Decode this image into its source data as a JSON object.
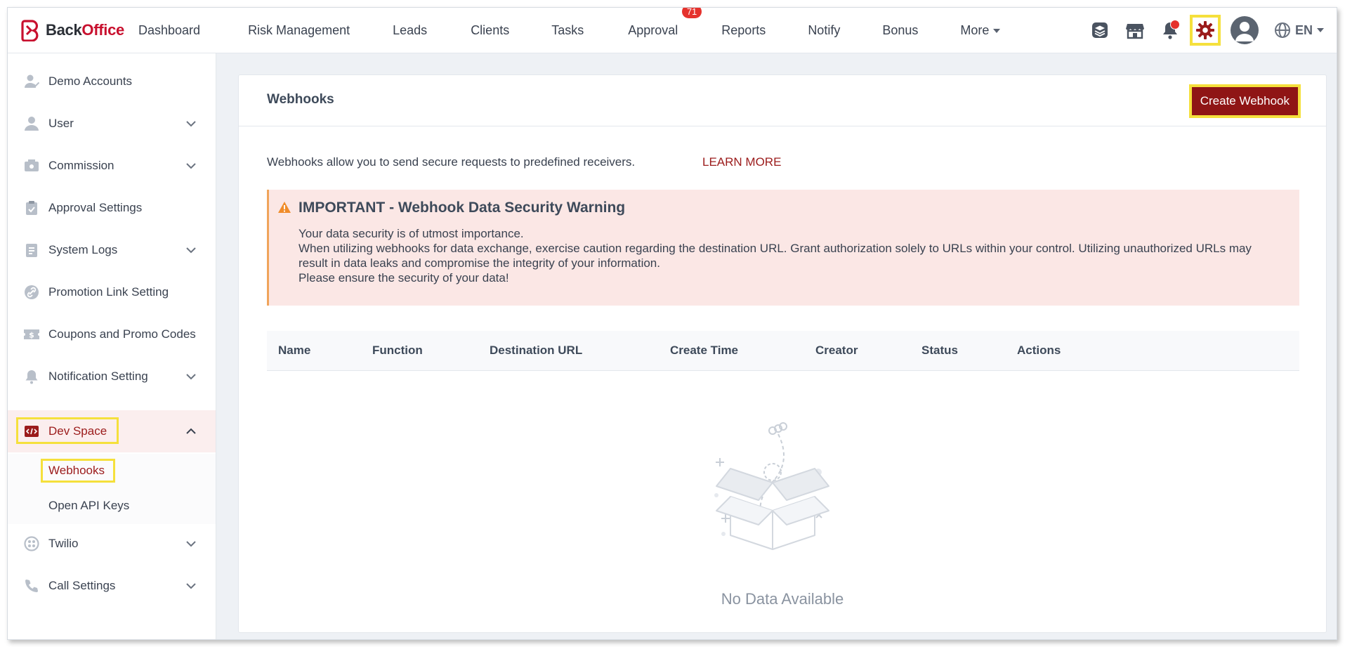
{
  "brand": {
    "prefix": "Back",
    "accent": "Office",
    "color": "#c8102e"
  },
  "nav": {
    "items": [
      {
        "label": "Dashboard"
      },
      {
        "label": "Risk Management"
      },
      {
        "label": "Leads"
      },
      {
        "label": "Clients"
      },
      {
        "label": "Tasks"
      },
      {
        "label": "Approval",
        "badge": "71"
      },
      {
        "label": "Reports"
      },
      {
        "label": "Notify"
      },
      {
        "label": "Bonus"
      },
      {
        "label": "More"
      }
    ]
  },
  "topbar": {
    "icons": [
      "layers-icon",
      "store-icon",
      "bell-icon",
      "gear-icon",
      "avatar",
      "globe-icon"
    ],
    "language": "EN"
  },
  "sidebar": {
    "items": [
      {
        "label": "Demo Accounts",
        "icon": "user-check-icon"
      },
      {
        "label": "User",
        "icon": "user-icon",
        "expandable": true
      },
      {
        "label": "Commission",
        "icon": "commission-icon",
        "expandable": true
      },
      {
        "label": "Approval Settings",
        "icon": "clipboard-icon"
      },
      {
        "label": "System Logs",
        "icon": "log-icon",
        "expandable": true
      },
      {
        "label": "Promotion Link Setting",
        "icon": "link-icon"
      },
      {
        "label": "Coupons and Promo Codes",
        "icon": "coupon-icon"
      },
      {
        "label": "Notification Setting",
        "icon": "bell-icon",
        "expandable": true
      },
      {
        "label": "Dev Space",
        "icon": "code-icon",
        "expandable": true,
        "expanded": true
      },
      {
        "label": "Twilio",
        "icon": "twilio-icon",
        "expandable": true
      },
      {
        "label": "Call Settings",
        "icon": "phone-icon",
        "expandable": true
      }
    ],
    "dev_space_children": [
      {
        "label": "Webhooks",
        "active": true
      },
      {
        "label": "Open API Keys"
      }
    ]
  },
  "main": {
    "title": "Webhooks",
    "create_button": "Create Webhook",
    "intro": "Webhooks allow you to send secure requests to predefined receivers.",
    "learn_more": "LEARN MORE",
    "warning": {
      "title": "IMPORTANT - Webhook Data Security Warning",
      "lines": [
        "Your data security is of utmost importance.",
        "When utilizing webhooks for data exchange, exercise caution regarding the destination URL. Grant authorization solely to URLs within your control. Utilizing unauthorized URLs may result in data leaks and compromise the integrity of your information.",
        "Please ensure the security of your data!"
      ]
    },
    "table": {
      "columns": [
        "Name",
        "Function",
        "Destination URL",
        "Create Time",
        "Creator",
        "Status",
        "Actions"
      ],
      "rows": []
    },
    "empty_text": "No Data Available"
  },
  "colors": {
    "accent": "#8f1515",
    "highlight": "#f5e03c",
    "warning_bg": "#fbe7e5",
    "warning_border": "#f0a45b",
    "badge": "#e5322d"
  }
}
